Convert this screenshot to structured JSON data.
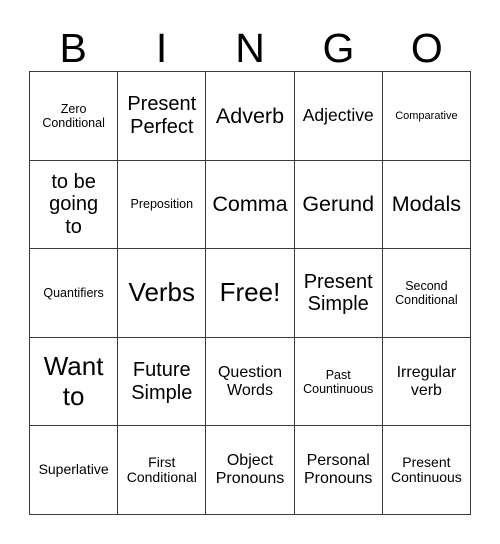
{
  "card": {
    "header_letters": [
      "B",
      "I",
      "N",
      "G",
      "O"
    ],
    "colors": {
      "background": "#ffffff",
      "text": "#000000",
      "grid_line": "#3a3a3a"
    },
    "rows": [
      [
        {
          "text": "Zero\nConditional",
          "size": "fs-s"
        },
        {
          "text": "Present\nPerfect",
          "size": "fs-l"
        },
        {
          "text": "Adverb",
          "size": "fs-xl"
        },
        {
          "text": "Adjective",
          "size": "fs-ml"
        },
        {
          "text": "Comparative",
          "size": "fs-xs"
        }
      ],
      [
        {
          "text": "to be\ngoing\nto",
          "size": "fs-l"
        },
        {
          "text": "Preposition",
          "size": "fs-s"
        },
        {
          "text": "Comma",
          "size": "fs-xl"
        },
        {
          "text": "Gerund",
          "size": "fs-xl"
        },
        {
          "text": "Modals",
          "size": "fs-xl"
        }
      ],
      [
        {
          "text": "Quantifiers",
          "size": "fs-s"
        },
        {
          "text": "Verbs",
          "size": "fs-xxl"
        },
        {
          "text": "Free!",
          "size": "fs-xxl"
        },
        {
          "text": "Present\nSimple",
          "size": "fs-l"
        },
        {
          "text": "Second\nConditional",
          "size": "fs-s"
        }
      ],
      [
        {
          "text": "Want\nto",
          "size": "fs-xxl"
        },
        {
          "text": "Future\nSimple",
          "size": "fs-l"
        },
        {
          "text": "Question\nWords",
          "size": "fs-m"
        },
        {
          "text": "Past\nCountinuous",
          "size": "fs-s"
        },
        {
          "text": "Irregular\nverb",
          "size": "fs-m"
        }
      ],
      [
        {
          "text": "Superlative",
          "size": "fs-sm"
        },
        {
          "text": "First\nConditional",
          "size": "fs-sm"
        },
        {
          "text": "Object\nPronouns",
          "size": "fs-m"
        },
        {
          "text": "Personal\nPronouns",
          "size": "fs-m"
        },
        {
          "text": "Present\nContinuous",
          "size": "fs-sm"
        }
      ]
    ]
  }
}
